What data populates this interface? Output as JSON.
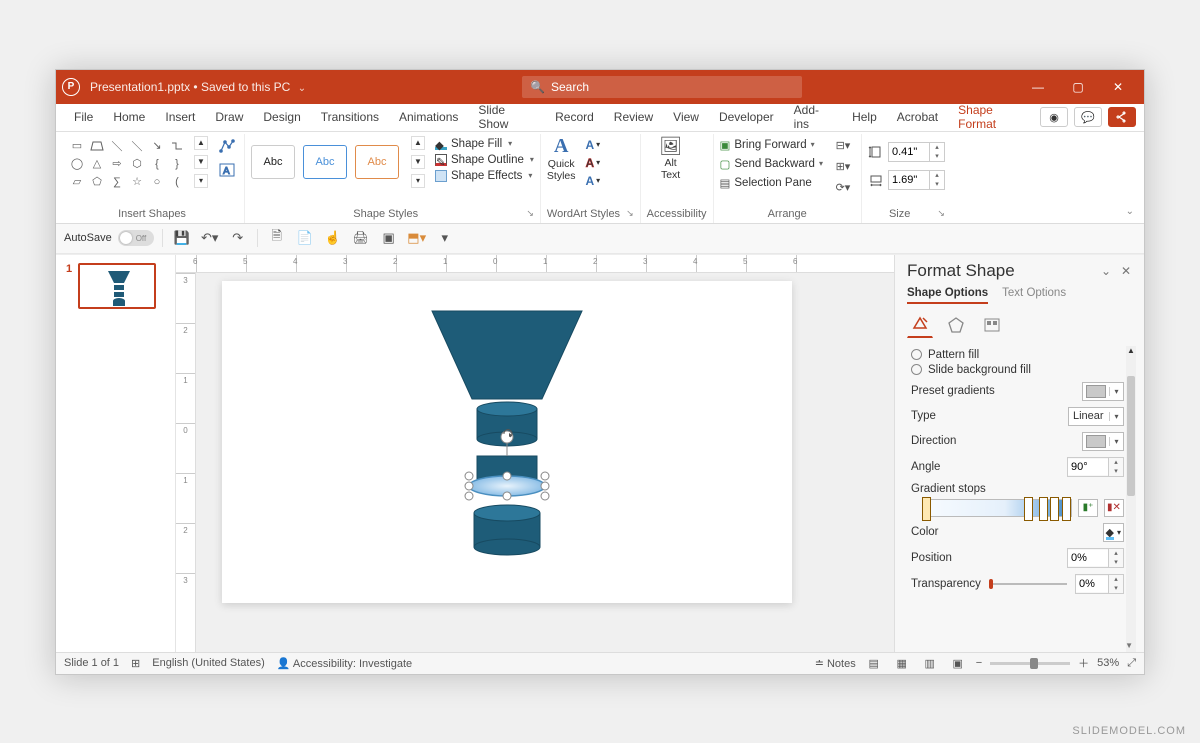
{
  "titlebar": {
    "filename": "Presentation1.pptx",
    "save_state": "Saved to this PC",
    "search_placeholder": "Search"
  },
  "tabs": [
    "File",
    "Home",
    "Insert",
    "Draw",
    "Design",
    "Transitions",
    "Animations",
    "Slide Show",
    "Record",
    "Review",
    "View",
    "Developer",
    "Add-ins",
    "Help",
    "Acrobat",
    "Shape Format"
  ],
  "ribbon": {
    "insert_shapes_label": "Insert Shapes",
    "shape_styles_label": "Shape Styles",
    "wordart_styles_label": "WordArt Styles",
    "accessibility_label": "Accessibility",
    "arrange_label": "Arrange",
    "size_label": "Size",
    "shape_fill": "Shape Fill",
    "shape_outline": "Shape Outline",
    "shape_effects": "Shape Effects",
    "quick_styles": "Quick\nStyles",
    "alt_text": "Alt\nText",
    "bring_forward": "Bring Forward",
    "send_backward": "Send Backward",
    "selection_pane": "Selection Pane",
    "style_sample": "Abc",
    "size_height": "0.41\"",
    "size_width": "1.69\""
  },
  "qat": {
    "autosave_label": "AutoSave",
    "autosave_state": "Off"
  },
  "thumb": {
    "number": "1"
  },
  "format_pane": {
    "title": "Format Shape",
    "tab_shape": "Shape Options",
    "tab_text": "Text Options",
    "pattern_fill": "Pattern fill",
    "slide_bg_fill": "Slide background fill",
    "preset_gradients": "Preset gradients",
    "type_label": "Type",
    "type_value": "Linear",
    "direction": "Direction",
    "angle_label": "Angle",
    "angle_value": "90°",
    "gradient_stops": "Gradient stops",
    "color_label": "Color",
    "position_label": "Position",
    "position_value": "0%",
    "transparency_label": "Transparency",
    "transparency_value": "0%"
  },
  "status": {
    "slide_indicator": "Slide 1 of 1",
    "language": "English (United States)",
    "accessibility": "Accessibility: Investigate",
    "notes": "Notes",
    "zoom": "53%"
  },
  "watermark": "SLIDEMODEL.COM",
  "ruler_h": [
    "6",
    "5",
    "4",
    "3",
    "2",
    "1",
    "0",
    "1",
    "2",
    "3",
    "4",
    "5",
    "6"
  ],
  "ruler_v": [
    "3",
    "2",
    "1",
    "0",
    "1",
    "2",
    "3"
  ]
}
